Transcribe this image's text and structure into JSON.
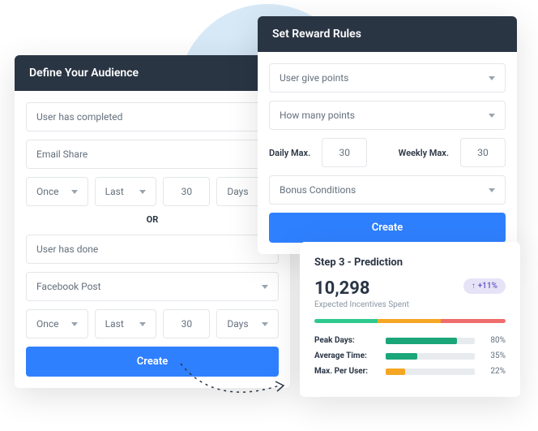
{
  "audience": {
    "title": "Define Your Audience",
    "completed": "User has completed",
    "emailShare": "Email Share",
    "once1": "Once",
    "last1": "Last",
    "num1": "30",
    "days1": "Days",
    "or": "OR",
    "done": "User has done",
    "facebook": "Facebook Post",
    "once2": "Once",
    "last2": "Last",
    "num2": "30",
    "days2": "Days",
    "create": "Create"
  },
  "reward": {
    "title": "Set Reward Rules",
    "givePoints": "User give points",
    "howMany": "How many points",
    "dailyLabel": "Daily Max.",
    "dailyVal": "30",
    "weeklyLabel": "Weekly Max.",
    "weeklyVal": "30",
    "bonus": "Bonus Conditions",
    "create": "Create"
  },
  "prediction": {
    "title": "Step 3 - Prediction",
    "value": "10,298",
    "sub": "Expected Incentives Spent",
    "badge": "+11%",
    "metrics": [
      {
        "label": "Peak Days:",
        "pct": 80,
        "color": "#1aa678",
        "text": "80%"
      },
      {
        "label": "Average Time:",
        "pct": 35,
        "color": "#1aa678",
        "text": "35%"
      },
      {
        "label": "Max. Per User:",
        "pct": 22,
        "color": "#f5a623",
        "text": "22%"
      }
    ]
  },
  "chart_data": {
    "type": "bar",
    "title": "Step 3 - Prediction",
    "categories": [
      "Peak Days",
      "Average Time",
      "Max. Per User"
    ],
    "values": [
      80,
      35,
      22
    ],
    "ylim": [
      0,
      100
    ],
    "xlabel": "",
    "ylabel": "%"
  }
}
